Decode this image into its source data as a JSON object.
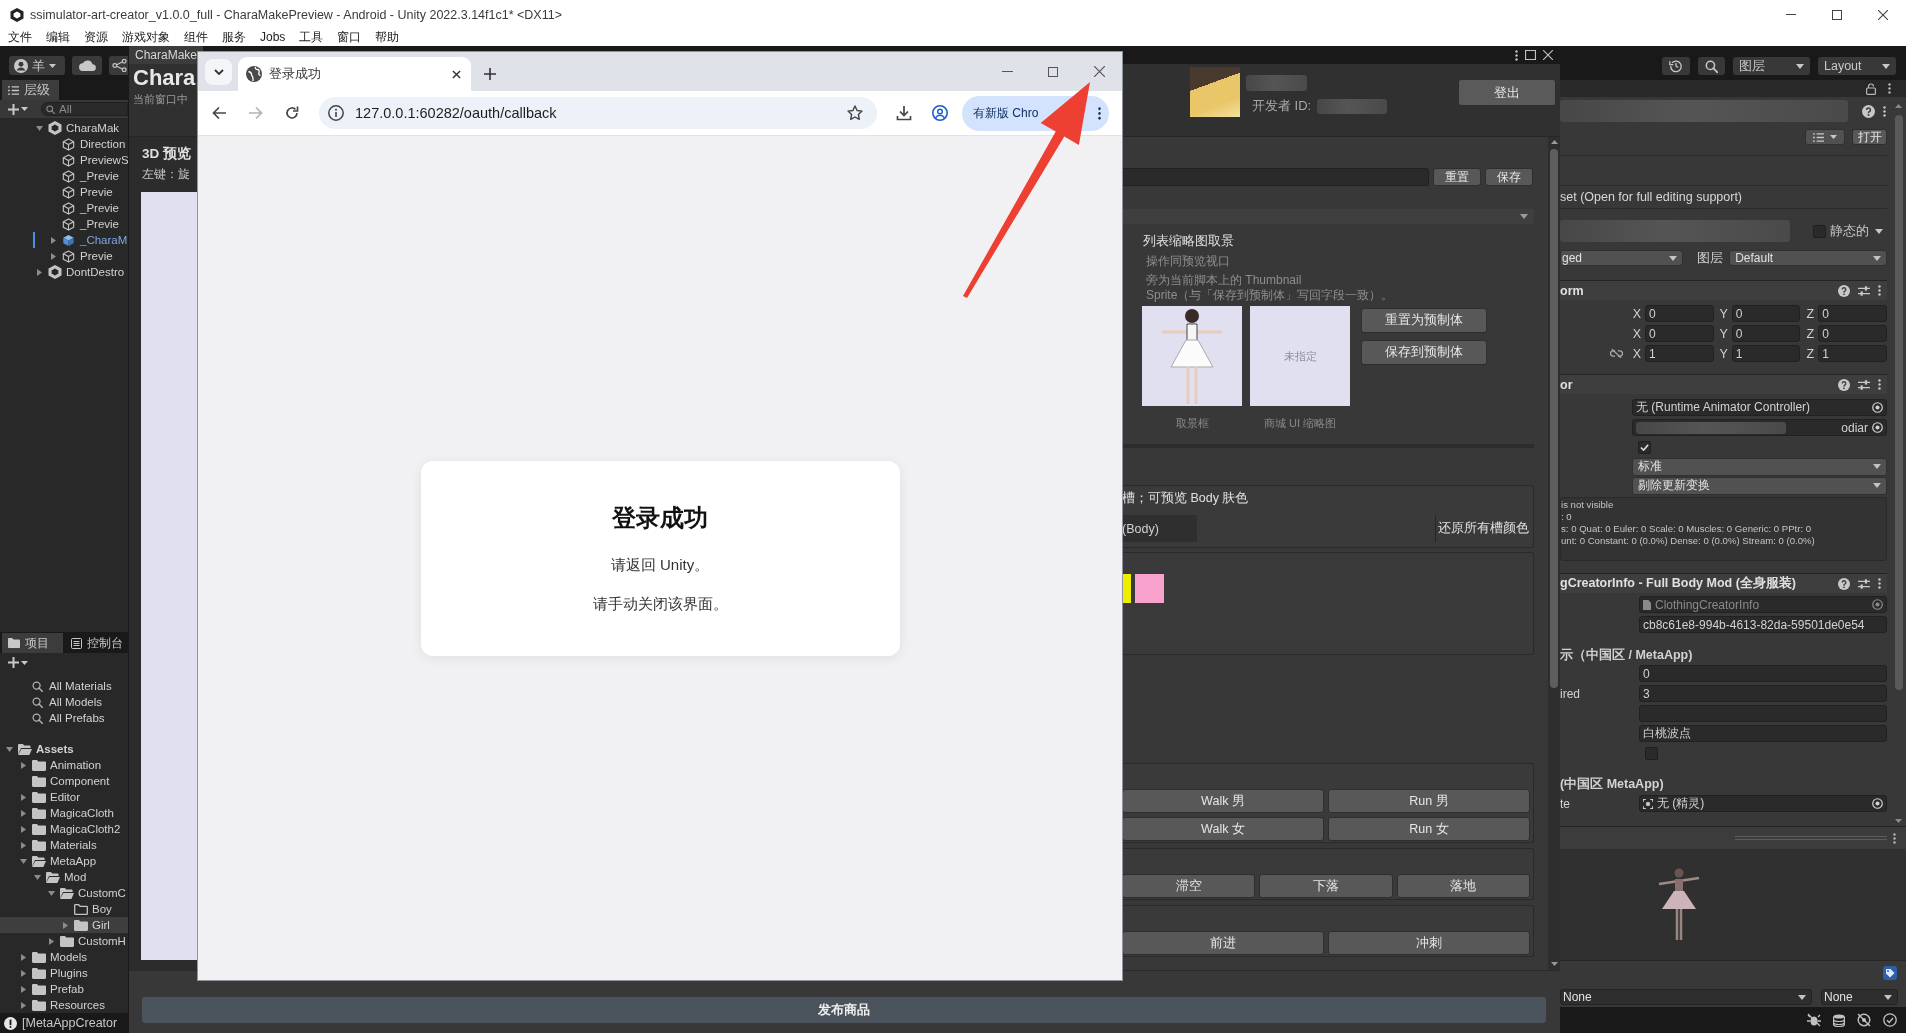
{
  "unity_window": {
    "title": "ssimulator-art-creator_v1.0.0_full - CharaMakePreview - Android - Unity 2022.3.14f1c1* <DX11>"
  },
  "menu": [
    "文件",
    "编辑",
    "资源",
    "游戏对象",
    "组件",
    "服务",
    "Jobs",
    "工具",
    "窗口",
    "帮助"
  ],
  "toolbar": {
    "account": "羊",
    "layers": "图层",
    "layout": "Layout"
  },
  "hierarchy": {
    "tab": "层级",
    "search": {
      "placeholder": "All"
    },
    "items": [
      {
        "label": "CharaMak",
        "kind": "scene",
        "expanded": true,
        "children": [
          {
            "label": "Direction",
            "kind": "object"
          },
          {
            "label": "PreviewS",
            "kind": "object"
          },
          {
            "label": "_Previe",
            "kind": "object"
          },
          {
            "label": "Previe",
            "kind": "object"
          },
          {
            "label": "_Previe",
            "kind": "object"
          },
          {
            "label": "_Previe",
            "kind": "object"
          },
          {
            "label": "_CharaM",
            "kind": "prefab",
            "expanded": false
          },
          {
            "label": "Previe",
            "kind": "object",
            "expanded": false
          }
        ]
      },
      {
        "label": "DontDestro",
        "kind": "scene",
        "expanded": false
      }
    ]
  },
  "project": {
    "tabs": [
      {
        "label": "项目",
        "kind": "folder",
        "selected": true
      },
      {
        "label": "控制台",
        "kind": "console",
        "selected": false
      }
    ],
    "searches": [
      "All Materials",
      "All Models",
      "All Prefabs"
    ],
    "tree": [
      {
        "label": "Assets",
        "kind": "folder",
        "expanded": true,
        "selected": false,
        "children": [
          {
            "label": "Animation",
            "kind": "folder",
            "expanded": false,
            "selected": false
          },
          {
            "label": "Component",
            "kind": "folder",
            "selected": false
          },
          {
            "label": "Editor",
            "kind": "folder",
            "expanded": false,
            "selected": false
          },
          {
            "label": "MagicaCloth",
            "kind": "folder",
            "expanded": false,
            "selected": false
          },
          {
            "label": "MagicaCloth2",
            "kind": "folder",
            "expanded": false,
            "selected": false
          },
          {
            "label": "Materials",
            "kind": "folder",
            "expanded": false,
            "selected": false
          },
          {
            "label": "MetaApp",
            "kind": "folder",
            "expanded": true,
            "selected": false,
            "children": [
              {
                "label": "Mod",
                "kind": "folder",
                "expanded": true,
                "selected": false,
                "children": [
                  {
                    "label": "CustomC",
                    "kind": "folder",
                    "expanded": true,
                    "selected": false,
                    "children": [
                      {
                        "label": "Boy",
                        "kind": "empty-folder",
                        "selected": false
                      },
                      {
                        "label": "Girl",
                        "kind": "folder",
                        "expanded": false,
                        "selected": true
                      }
                    ]
                  },
                  {
                    "label": "CustomH",
                    "kind": "folder",
                    "expanded": false,
                    "selected": false
                  }
                ]
              }
            ]
          },
          {
            "label": "Models",
            "kind": "folder",
            "expanded": false,
            "selected": false
          },
          {
            "label": "Plugins",
            "kind": "folder",
            "expanded": false,
            "selected": false
          },
          {
            "label": "Prefab",
            "kind": "folder",
            "expanded": false,
            "selected": false
          },
          {
            "label": "Resources",
            "kind": "folder",
            "expanded": false,
            "selected": false
          }
        ]
      }
    ]
  },
  "status_bar": {
    "message": "[MetaAppCreator"
  },
  "editor": {
    "tab": "CharaMake",
    "title": "Chara",
    "subtitle": "当前窗口中",
    "developer_id_label": "开发者 ID:",
    "logout_button": "登出",
    "preview": {
      "title": "3D 预览",
      "hint": "左键：旋"
    },
    "form": {
      "name_buttons": [
        "重置",
        "保存"
      ],
      "thumbnail": {
        "title": "列表缩略图取景",
        "hint": "操作同预览视口",
        "description": "旁为当前脚本上的 Thumbnail\nSprite（与「保存到预制体」写回字段一致）。",
        "frames": [
          {
            "kind": "render",
            "caption": "取景框"
          },
          {
            "kind": "empty",
            "text": "未指定",
            "caption": "商城 UI 缩略图"
          }
        ],
        "buttons": [
          "重置为预制体",
          "保存到预制体"
        ]
      },
      "skin": {
        "caption": "槽；可预览 Body 肤色",
        "slot": "(Body)",
        "reset_button": "还原所有槽颜色",
        "swatches": [
          {
            "color": "#f0ee00"
          },
          {
            "color": "#f9a2ce"
          }
        ]
      },
      "action_groups": [
        [
          [
            "Walk 男",
            "Run 男"
          ],
          [
            "Walk 女",
            "Run 女"
          ]
        ],
        [
          [
            "滞空",
            "下落",
            "落地"
          ]
        ],
        [
          [
            "前进",
            "冲刺"
          ]
        ]
      ]
    },
    "publish_button": "发布商品"
  },
  "inspector": {
    "open_button": "打开",
    "asset_note": "set (Open for full editing support)",
    "static": {
      "label": "静态的",
      "checked": false
    },
    "tag": "ged",
    "layer_label": "图层",
    "layer": "Default",
    "components": [
      {
        "kind": "transform",
        "title": "orm",
        "rows": [
          {
            "kind": "vector",
            "fields": [
              {
                "axis": "X",
                "value": "0"
              },
              {
                "axis": "Y",
                "value": "0"
              },
              {
                "axis": "Z",
                "value": "0"
              }
            ]
          },
          {
            "kind": "vector",
            "fields": [
              {
                "axis": "X",
                "value": "0"
              },
              {
                "axis": "Y",
                "value": "0"
              },
              {
                "axis": "Z",
                "value": "0"
              }
            ]
          },
          {
            "kind": "scale",
            "fields": [
              {
                "axis": "X",
                "value": "1"
              },
              {
                "axis": "Y",
                "value": "1"
              },
              {
                "axis": "Z",
                "value": "1"
              }
            ]
          }
        ]
      },
      {
        "kind": "animator",
        "title": "or",
        "controller": "无 (Runtime Animator Controller)",
        "avatar": "odiar",
        "root_motion": {
          "checked": true
        },
        "update_mode": "标准",
        "culling_mode": "剔除更新变换",
        "info": [
          "is not visible",
          ": 0",
          "s: 0 Quat: 0 Euler: 0 Scale: 0 Muscles: 0 Generic: 0 PPtr: 0",
          "unt: 0 Constant: 0 (0.0%) Dense: 0 (0.0%) Stream: 0 (0.0%)"
        ]
      },
      {
        "kind": "script",
        "title": "gCreatorInfo - Full Body Mod (全身服装)",
        "script": "ClothingCreatorInfo",
        "properties": [
          {
            "kind": "text",
            "value": "cb8c61e8-994b-4613-82da-59501de0e54"
          },
          {
            "kind": "heading",
            "label": "示（中国区 / MetaApp)"
          },
          {
            "kind": "text",
            "value": "0"
          },
          {
            "kind": "text",
            "label": "ired",
            "value": "3"
          },
          {
            "kind": "text"
          },
          {
            "kind": "text",
            "value": "白桃波点"
          },
          {
            "kind": "checkbox",
            "checked": false
          },
          {
            "kind": "heading",
            "label": "(中国区 MetaApp)"
          },
          {
            "kind": "object",
            "label": "te",
            "value": "无 (精灵)"
          }
        ]
      }
    ],
    "preview_dropdowns": [
      "None",
      "None"
    ]
  },
  "browser": {
    "tabs": [
      {
        "title": "登录成功",
        "selected": true
      }
    ],
    "url": "127.0.0.1:60282/oauth/callback",
    "update_button": "有新版 Chro",
    "page": {
      "heading": "登录成功",
      "lines": [
        "请返回 Unity。",
        "请手动关闭该界面。"
      ]
    }
  }
}
